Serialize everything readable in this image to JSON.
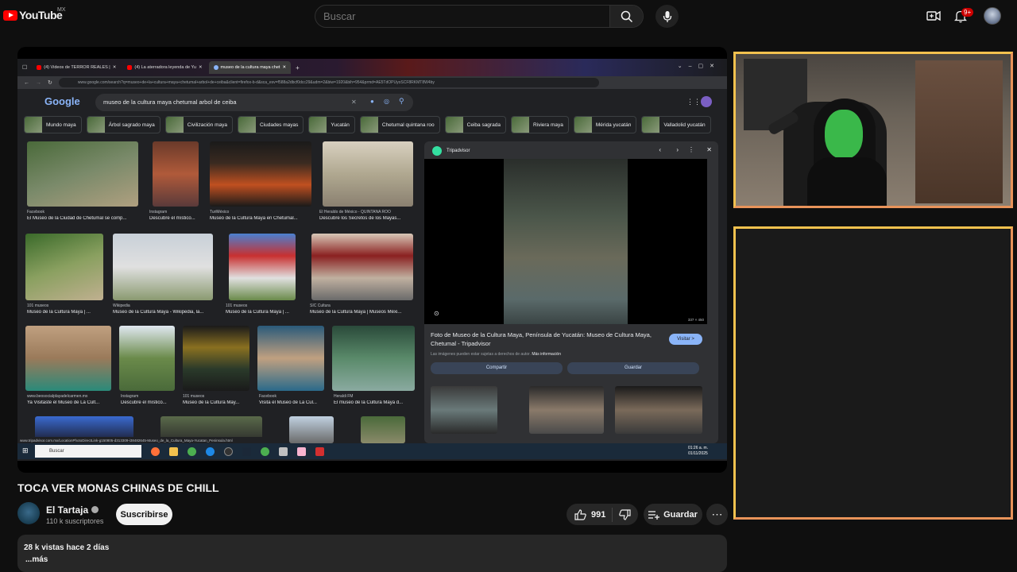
{
  "header": {
    "logo_text": "YouTube",
    "region": "MX",
    "search_placeholder": "Buscar",
    "notifications_badge": "9+"
  },
  "player": {
    "browser": {
      "tabs": [
        {
          "label": "(4) Videos de TERROR REALES |",
          "active": false
        },
        {
          "label": "(4) La aterradora leyenda de Yu",
          "active": false
        },
        {
          "label": "museo de la cultura maya chet",
          "active": true
        }
      ],
      "address": "www.google.com/search?q=museo+de+la+cultura+maya+chetumal+arbol+de+ceiba&client=firefox-b-d&sca_esv=f588a2dbcf0dcc29&udm=2&biw=1920&bih=954&prmd=AE5TdOPUyoSCF8RKMT8W4by"
    },
    "google": {
      "logo": "Google",
      "query": "museo de la cultura maya chetumal arbol de ceiba",
      "chips": [
        "Mundo maya",
        "Árbol sagrado maya",
        "Civilización maya",
        "Ciudades mayas",
        "Yucatán",
        "Chetumal quintana roo",
        "Ceiba sagrada",
        "Riviera maya",
        "Mérida yucatán",
        "Valladolid yucatán"
      ],
      "results": [
        {
          "source": "Facebook",
          "title": "El Museo de la Ciudad de Chetumal se comp..."
        },
        {
          "source": "Instagram",
          "title": "Descubre el místico..."
        },
        {
          "source": "TuriMéxico",
          "title": "Museo de la Cultura Maya en Chetumal..."
        },
        {
          "source": "El Heraldo de México - QUINTANA ROO",
          "title": "Descubre los Secretos de los Mayas..."
        },
        {
          "source": "101 museos",
          "title": "Museo de la Cultura Maya | ..."
        },
        {
          "source": "Wikipedia",
          "title": "Museo de la Cultura Maya - Wikipedia, la..."
        },
        {
          "source": "101 museos",
          "title": "Museo de la Cultura Maya | ..."
        },
        {
          "source": "SIC Cultura",
          "title": "Museo de la Cultura Maya | Museos Méxi..."
        },
        {
          "source": "www.beosocialplayadelcarmen.mx",
          "title": "Ya Visitaste el Museo de La Cult..."
        },
        {
          "source": "Instagram",
          "title": "Descubre el místico..."
        },
        {
          "source": "101 museos",
          "title": "Museo de la Cultura May..."
        },
        {
          "source": "Facebook",
          "title": "Visita el Museo de La Cul..."
        },
        {
          "source": "Heraldi FM",
          "title": "El museo de la Cultura Maya d..."
        }
      ],
      "panel": {
        "source": "Tripadvisor",
        "dims": "337 × 450",
        "title": "Foto de Museo de la Cultura Maya, Península de Yucatán: Museo de Cultura Maya, Chetumal - Tripadvisor",
        "visit_label": "Visitar >",
        "note": "Las imágenes pueden estar sujetas a derechos de autor.",
        "note_link": "Más información",
        "share_label": "Compartir",
        "save_label": "Guardar"
      },
      "status_url": "www.tripadvisor.com.mx/LocationPhotoDirectLink-g150805-d313309-i38482645-Museo_de_la_Cultura_Maya-Yucatan_Peninsula.html"
    },
    "taskbar": {
      "search": "Buscar",
      "time": "01:26 a. m.",
      "date": "01/11/2025"
    }
  },
  "video": {
    "title": "TOCA VER MONAS CHINAS DE CHILL",
    "channel_name": "El Tartaja",
    "subscribers": "110 k suscriptores",
    "subscribe_label": "Suscribirse",
    "likes": "991",
    "save_label": "Guardar",
    "views_date": "28 k vistas  hace 2 días",
    "more_label": "...más"
  },
  "colors": {
    "accent_red": "#ff0000",
    "frame_yellow": "#f2c14e",
    "frame_orange": "#e8935a"
  }
}
